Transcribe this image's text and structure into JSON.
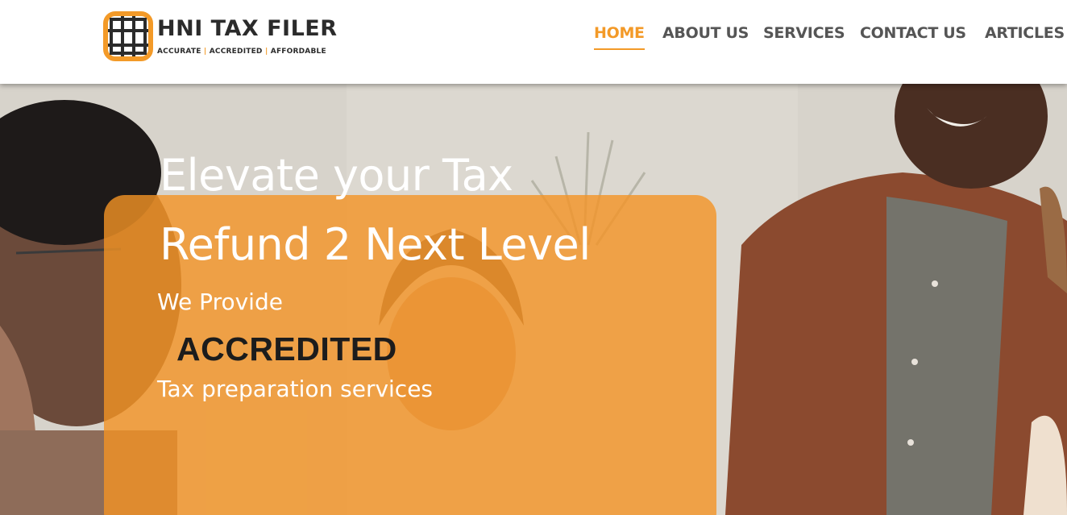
{
  "header": {
    "logo": {
      "title": "HNI TAX FILER",
      "tagline": {
        "part1": "ACCURATE",
        "sep1": "|",
        "part2": "ACCREDITED",
        "sep2": "|",
        "part3": "AFFORDABLE"
      }
    },
    "nav": {
      "items": [
        {
          "label": "HOME",
          "active": true
        },
        {
          "label": "ABOUT US",
          "active": false
        },
        {
          "label": "SERVICES",
          "active": false
        },
        {
          "label": "CONTACT US",
          "active": false
        },
        {
          "label": "ARTICLES",
          "active": false
        }
      ]
    }
  },
  "hero": {
    "headline": {
      "line1": "Elevate your Tax",
      "line2": "Refund 2 Next Level"
    },
    "intro": "We Provide",
    "keyword": "ACCREDITED",
    "service": "Tax preparation services"
  },
  "colors": {
    "accent": "#f39a28",
    "nav_text": "#555555",
    "card_overlay": "#f49424",
    "keyword_text": "#1c1c1c"
  }
}
